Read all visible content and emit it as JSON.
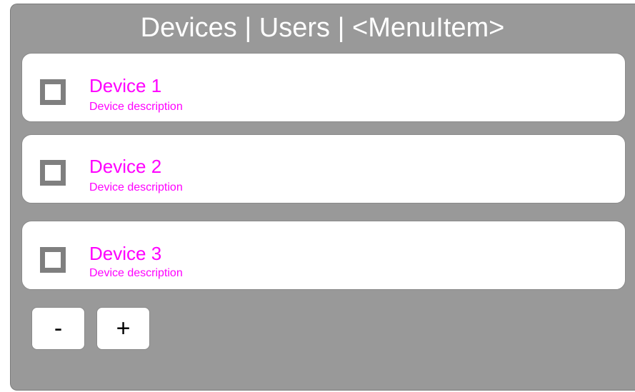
{
  "menu": {
    "items": [
      "Devices",
      "Users",
      "<MenuItem>"
    ],
    "separator": "|"
  },
  "devices": [
    {
      "name": "Device 1",
      "description": "Device description",
      "checked": false
    },
    {
      "name": "Device 2",
      "description": "Device description",
      "checked": false
    },
    {
      "name": "Device 3",
      "description": "Device description",
      "checked": false
    }
  ],
  "buttons": {
    "remove_label": "-",
    "add_label": "+"
  },
  "colors": {
    "panel": "#999999",
    "accent_text": "#ff00ff",
    "checkbox": "#7f7f7f",
    "card": "#ffffff"
  }
}
